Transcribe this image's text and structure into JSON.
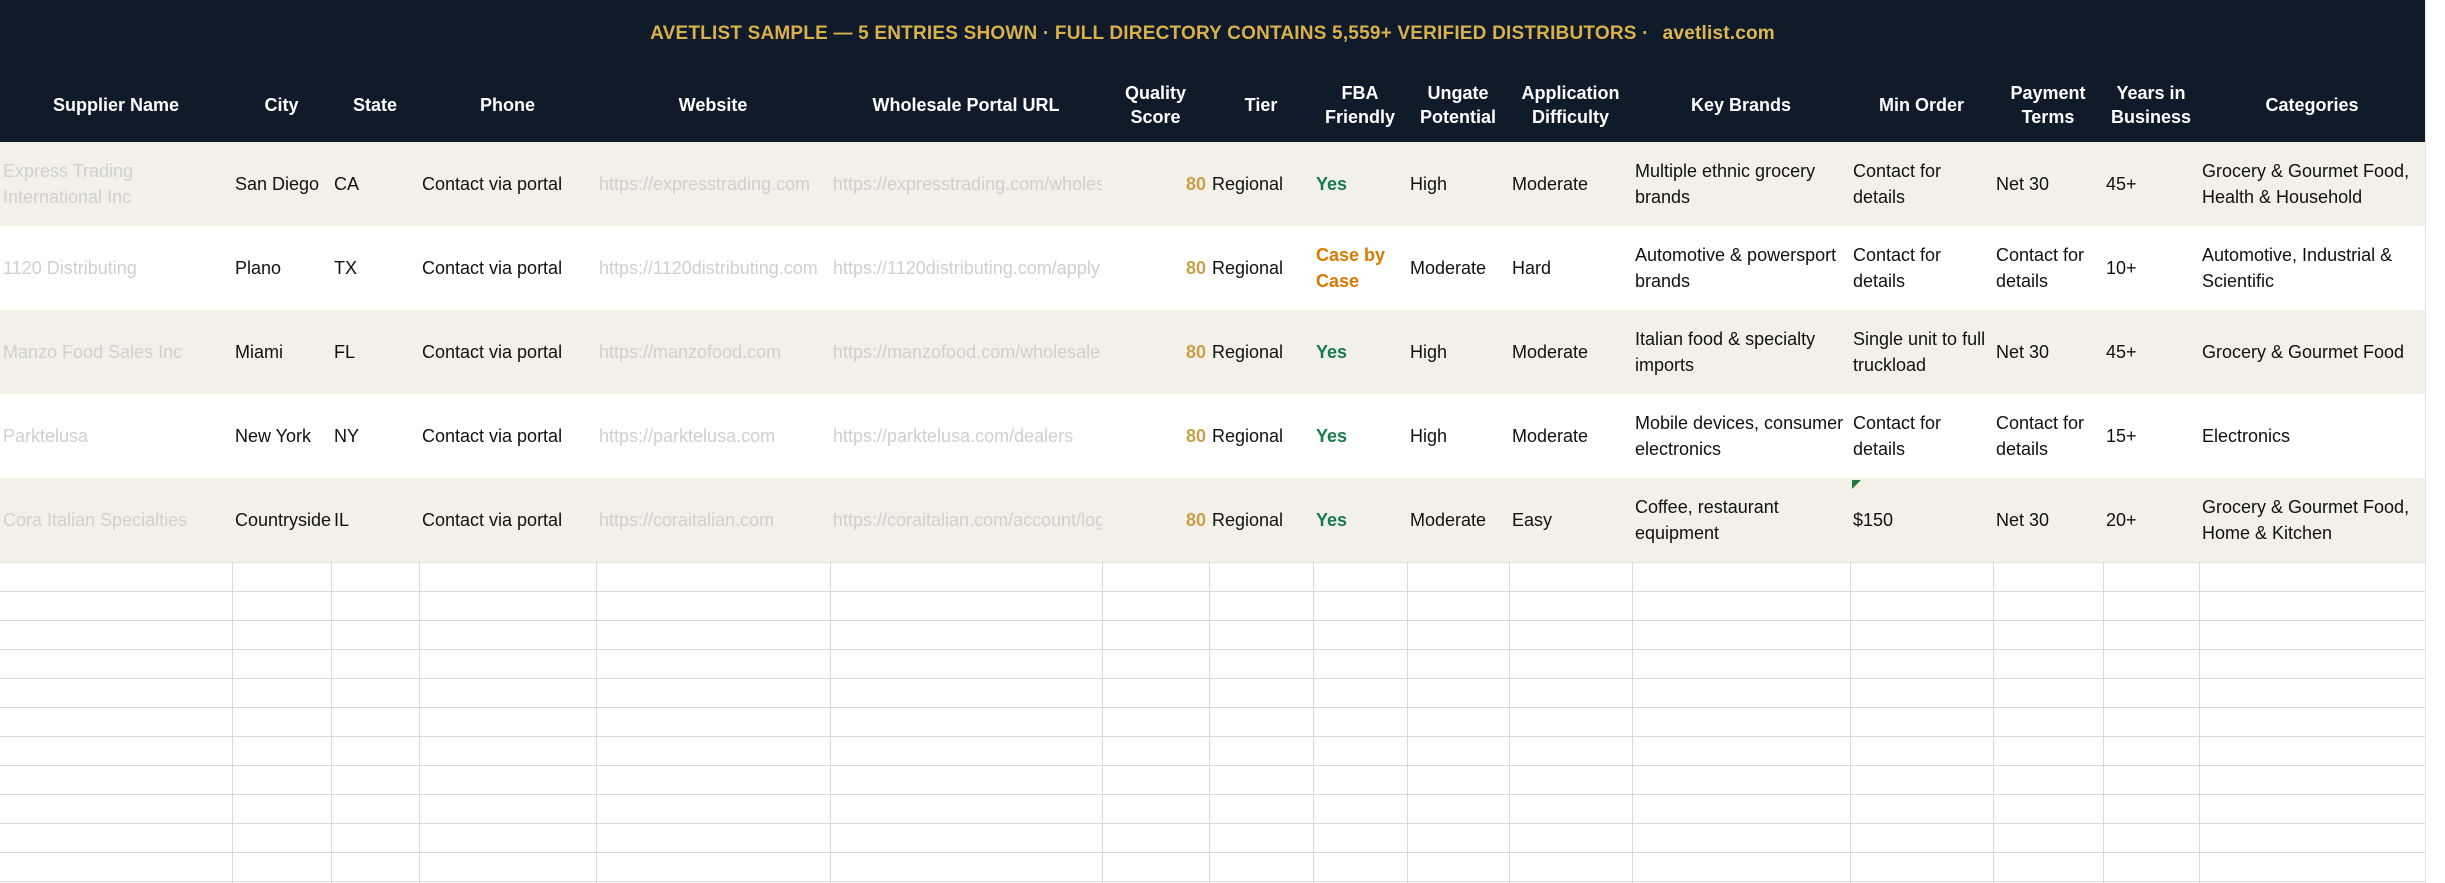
{
  "banner": {
    "text": "AVETLIST SAMPLE — 5 ENTRIES SHOWN  ·  FULL DIRECTORY CONTAINS 5,559+ VERIFIED DISTRIBUTORS  ·",
    "url": "avetlist.com"
  },
  "headers": [
    "Supplier Name",
    "City",
    "State",
    "Phone",
    "Website",
    "Wholesale Portal URL",
    "Quality\nScore",
    "Tier",
    "FBA\nFriendly",
    "Ungate\nPotential",
    "Application\nDifficulty",
    "Key Brands",
    "Min Order",
    "Payment\nTerms",
    "Years in\nBusiness",
    "Categories"
  ],
  "rows": [
    {
      "supplier": "Express Trading International Inc",
      "city": "San Diego",
      "state": "CA",
      "phone": "Contact via portal",
      "website": "https://expresstrading.com",
      "portal": "https://expresstrading.com/wholesale",
      "score": "80",
      "tier": "Regional",
      "fba": "Yes",
      "ungate": "High",
      "difficulty": "Moderate",
      "brands": "Multiple ethnic grocery brands",
      "min_order": "Contact for details",
      "terms": "Net 30",
      "years": "45+",
      "categories": "Grocery & Gourmet Food, Health & Household"
    },
    {
      "supplier": "1120 Distributing",
      "city": "Plano",
      "state": "TX",
      "phone": "Contact via portal",
      "website": "https://1120distributing.com",
      "portal": "https://1120distributing.com/apply",
      "score": "80",
      "tier": "Regional",
      "fba": "Case by Case",
      "ungate": "Moderate",
      "difficulty": "Hard",
      "brands": "Automotive & powersport brands",
      "min_order": "Contact for details",
      "terms": "Contact for details",
      "years": "10+",
      "categories": "Automotive, Industrial & Scientific"
    },
    {
      "supplier": "Manzo Food Sales Inc",
      "city": "Miami",
      "state": "FL",
      "phone": "Contact via portal",
      "website": "https://manzofood.com",
      "portal": "https://manzofood.com/wholesale",
      "score": "80",
      "tier": "Regional",
      "fba": "Yes",
      "ungate": "High",
      "difficulty": "Moderate",
      "brands": "Italian food & specialty imports",
      "min_order": "Single unit to full truckload",
      "terms": "Net 30",
      "years": "45+",
      "categories": "Grocery & Gourmet Food"
    },
    {
      "supplier": "Parktelusa",
      "city": "New York",
      "state": "NY",
      "phone": "Contact via portal",
      "website": "https://parktelusa.com",
      "portal": "https://parktelusa.com/dealers",
      "score": "80",
      "tier": "Regional",
      "fba": "Yes",
      "ungate": "High",
      "difficulty": "Moderate",
      "brands": "Mobile devices, consumer electronics",
      "min_order": "Contact for details",
      "terms": "Contact for details",
      "years": "15+",
      "categories": "Electronics"
    },
    {
      "supplier": "Cora Italian Specialties",
      "city": "Countryside",
      "state": "IL",
      "phone": "Contact via portal",
      "website": "https://coraitalian.com",
      "portal": "https://coraitalian.com/account/login",
      "score": "80",
      "tier": "Regional",
      "fba": "Yes",
      "ungate": "Moderate",
      "difficulty": "Easy",
      "brands": "Coffee, restaurant equipment",
      "min_order": "$150",
      "terms": "Net 30",
      "years": "20+",
      "categories": "Grocery & Gourmet Food, Home & Kitchen"
    }
  ],
  "colors": {
    "banner_bg": "#0f1a2a",
    "banner_text": "#d9b04a",
    "header_text": "#ffffff",
    "row_alt": "#f3f0e8",
    "score": "#c9a14a",
    "yes": "#167c4c",
    "case": "#d97a00",
    "muted": "#cfcfcf"
  }
}
